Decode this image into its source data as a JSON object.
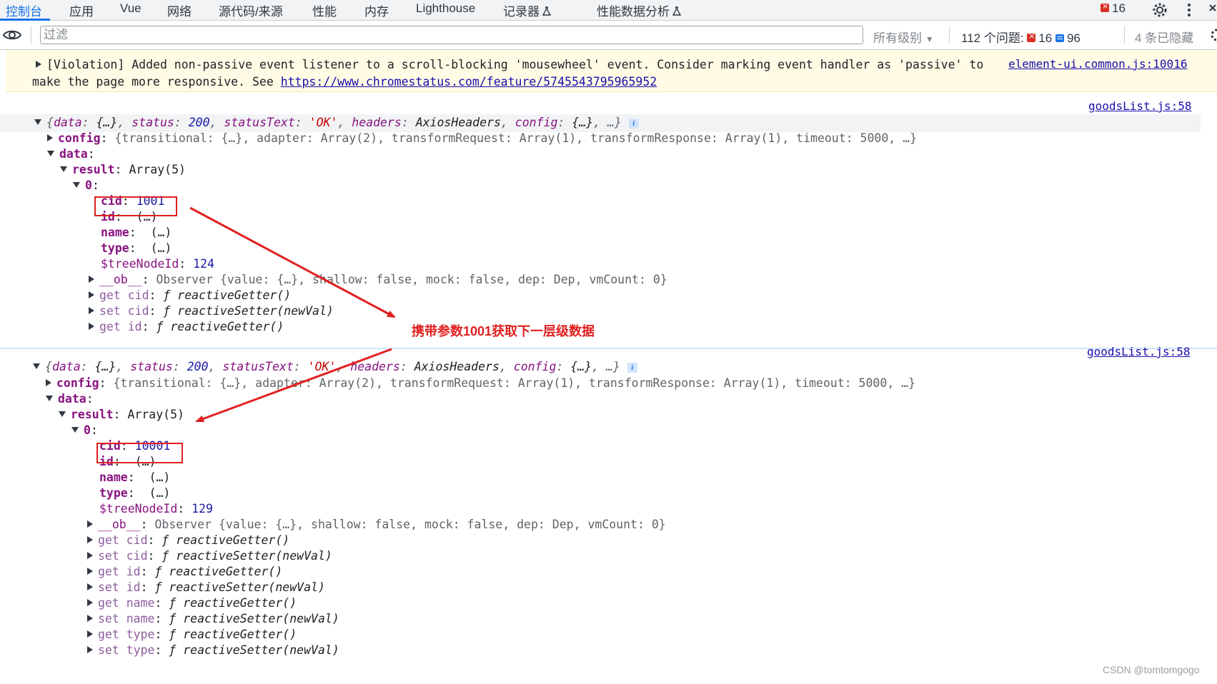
{
  "tabs": [
    "控制台",
    "应用",
    "Vue",
    "网络",
    "源代码/来源",
    "性能",
    "内存",
    "Lighthouse",
    "记录器",
    "性能数据分析"
  ],
  "header_error_count": "16",
  "toolbar": {
    "filter_placeholder": "过滤",
    "levels": "所有级别",
    "issues": "112 个问题:",
    "issue_errors": "16",
    "issue_messages": "96",
    "hidden": "4 条已隐藏"
  },
  "violation": {
    "text1": "[Violation] Added non-passive event listener to a scroll-blocking 'mousewheel' event. Consider marking event handler as 'passive' to",
    "text2": "make the page more responsive. See ",
    "link": "https://www.chromestatus.com/feature/5745543795965952",
    "source": "element-ui.common.js:10016"
  },
  "log1": {
    "source": "goodsList.js:58",
    "cid": "1001",
    "treeNodeId": "124"
  },
  "log2": {
    "source": "goodsList.js:58",
    "cid": "10001",
    "treeNodeId": "129"
  },
  "labels": {
    "summary_data": "data",
    "summary_data_val": "{…}",
    "status": "status",
    "status_val": "200",
    "statusText": "statusText",
    "statusText_val": "'OK'",
    "headers": "headers",
    "headers_val": "AxiosHeaders",
    "config": "config",
    "config_val": "{…}",
    "config_line": "{transitional: {…}, adapter: Array(2), transformRequest: Array(1), transformResponse: Array(1), timeout: 5000, …}",
    "data": "data",
    "result": "result",
    "result_val": "Array(5)",
    "index0": "0",
    "cid": "cid",
    "id": "id",
    "name": "name",
    "type": "type",
    "lazy": "(…)",
    "treeNodeId": "$treeNodeId",
    "ob": "__ob__",
    "ob_val": "Observer {value: {…}, shallow: false, mock: false, dep: Dep, vmCount: 0}"
  },
  "annotation": "携带参数1001获取下一层级数据",
  "watermark": "CSDN @tomtomgogo"
}
